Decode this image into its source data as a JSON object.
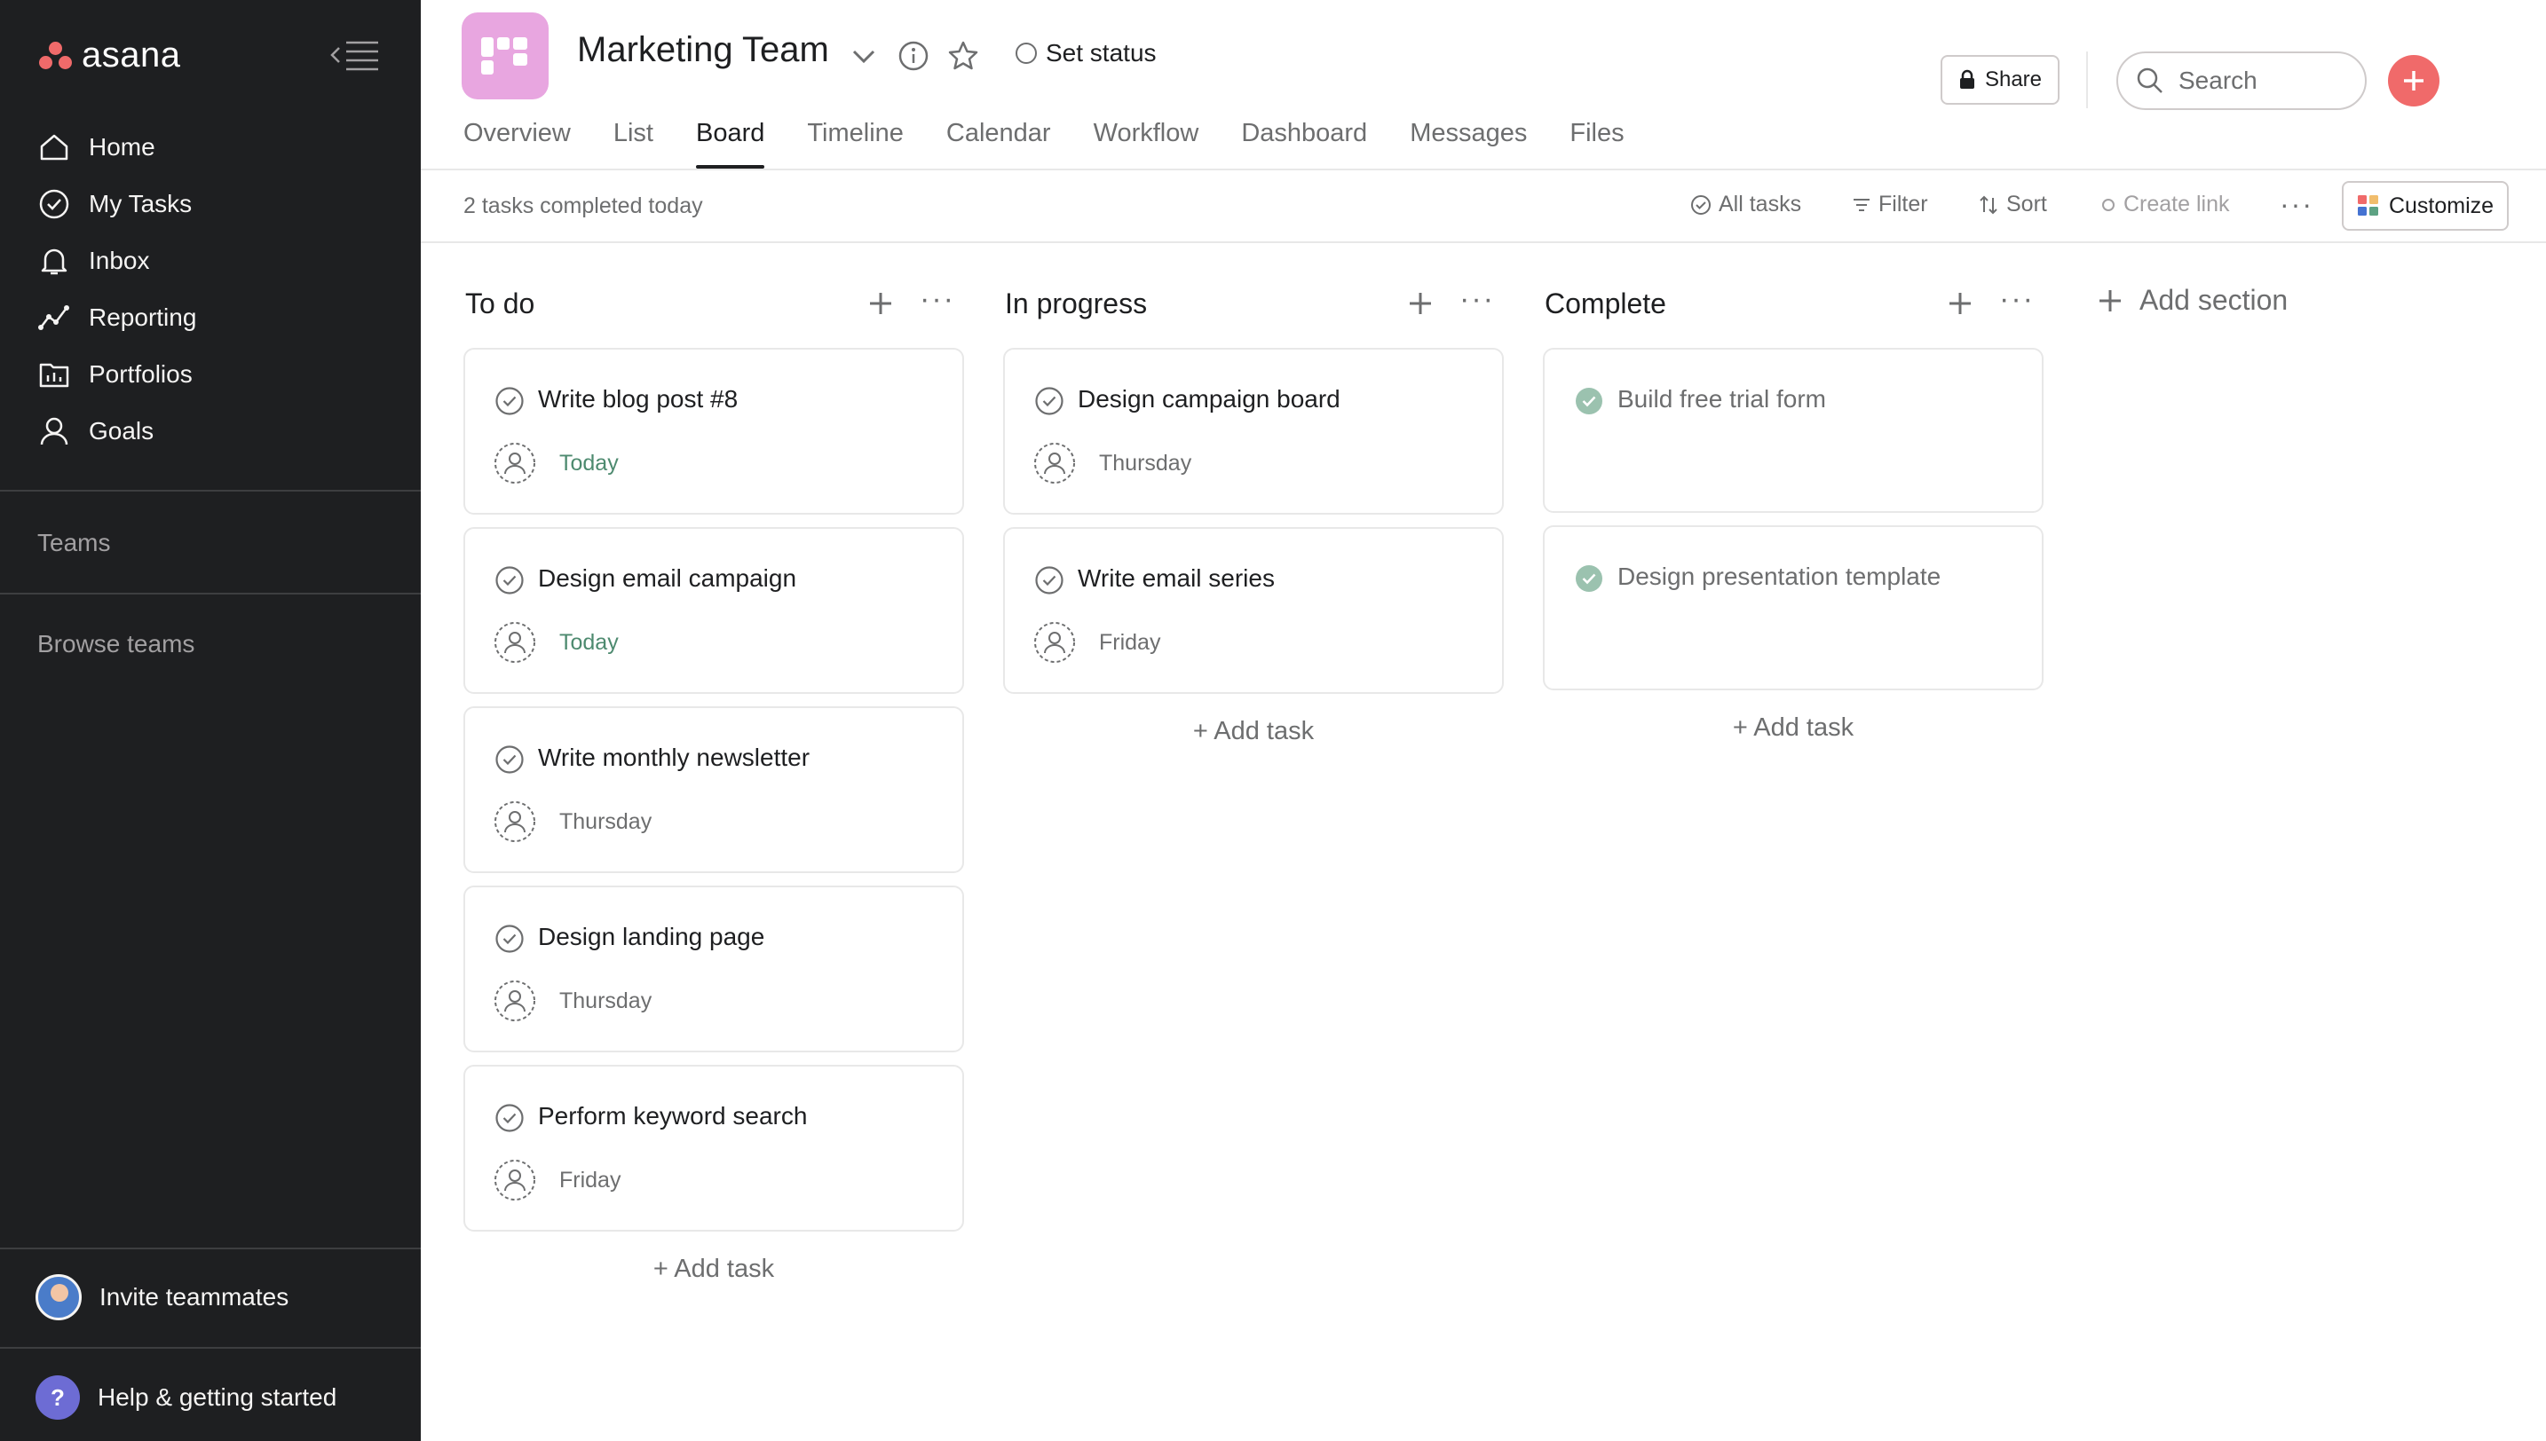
{
  "sidebar": {
    "logo_text": "asana",
    "nav": [
      {
        "label": "Home",
        "icon": "home-icon"
      },
      {
        "label": "My Tasks",
        "icon": "check-circle-icon"
      },
      {
        "label": "Inbox",
        "icon": "bell-icon"
      },
      {
        "label": "Reporting",
        "icon": "line-chart-icon"
      },
      {
        "label": "Portfolios",
        "icon": "folder-chart-icon"
      },
      {
        "label": "Goals",
        "icon": "person-icon"
      }
    ],
    "teams_label": "Teams",
    "browse_teams_label": "Browse teams",
    "invite_label": "Invite teammates",
    "help_label": "Help & getting started",
    "help_glyph": "?"
  },
  "header": {
    "project_title": "Marketing Team",
    "set_status": "Set status",
    "share_label": "Share",
    "search_placeholder": "Search",
    "tabs": [
      "Overview",
      "List",
      "Board",
      "Timeline",
      "Calendar",
      "Workflow",
      "Dashboard",
      "Messages",
      "Files"
    ],
    "active_tab": "Board"
  },
  "toolbar": {
    "completed_today": "2 tasks completed today",
    "all_tasks": "All tasks",
    "filter": "Filter",
    "sort": "Sort",
    "create_link": "Create link",
    "more": "···",
    "customize": "Customize"
  },
  "board": {
    "add_task_label": "+ Add task",
    "add_section_label": "Add section",
    "more_glyph": "···",
    "columns": [
      {
        "title": "To do",
        "tasks": [
          {
            "name": "Write blog post #8",
            "due": "Today"
          },
          {
            "name": "Design email campaign",
            "due": "Today"
          },
          {
            "name": "Write monthly newsletter",
            "due": "Thursday"
          },
          {
            "name": "Design landing page",
            "due": "Thursday"
          },
          {
            "name": "Perform keyword search",
            "due": "Friday"
          }
        ]
      },
      {
        "title": "In progress",
        "tasks": [
          {
            "name": "Design campaign board",
            "due": "Thursday"
          },
          {
            "name": "Write email series",
            "due": "Friday"
          }
        ]
      },
      {
        "title": "Complete",
        "tasks": [
          {
            "name": "Build free trial form",
            "completed": true
          },
          {
            "name": "Design presentation template",
            "completed": true
          }
        ]
      }
    ]
  },
  "colors": {
    "sidebar_bg": "#1e1f21",
    "accent_red": "#f06a6a",
    "project_icon": "#e8a6e0",
    "today_green": "#4d8a6f",
    "complete_check": "#58a182"
  }
}
